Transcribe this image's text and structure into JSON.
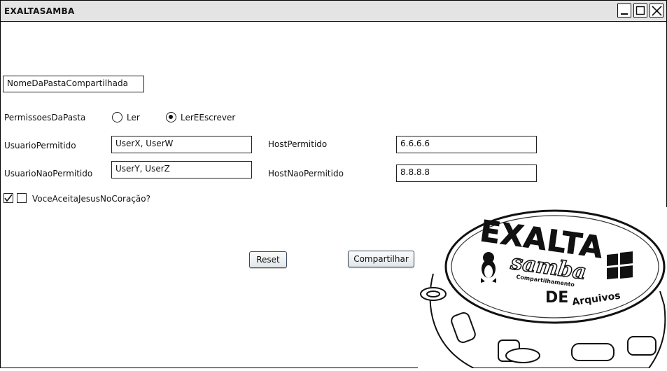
{
  "window": {
    "title": "EXALTASAMBA"
  },
  "form": {
    "share_name": "NomeDaPastaCompartilhada",
    "permissions": {
      "label": "PermissoesDaPasta",
      "options": [
        "Ler",
        "LerEEscrever"
      ],
      "selected": "LerEEscrever"
    },
    "allowed_users": {
      "label": "UsuarioPermitido",
      "value": "UserX, UserW"
    },
    "denied_users": {
      "label": "UsuarioNaoPermitido",
      "value": "UserY, UserZ"
    },
    "allowed_host": {
      "label": "HostPermitido",
      "value": "6.6.6.6"
    },
    "denied_host": {
      "label": "HostNaoPermitido",
      "value": "8.8.8.8"
    },
    "accept": {
      "label": "VoceAceitaJesusNoCoração?",
      "checked": true
    }
  },
  "buttons": {
    "reset": "Reset",
    "share": "Compartilhar"
  },
  "logo": {
    "text_main": "EXALTA",
    "text_script": "samba",
    "text_sub": "Compartilhamento",
    "text_de": "DE",
    "text_arquivos": "Arquivos"
  }
}
